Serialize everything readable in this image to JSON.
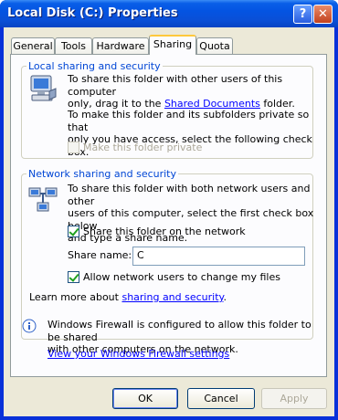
{
  "window": {
    "title": "Local Disk (C:) Properties",
    "help_glyph": "?",
    "close_glyph": "✕"
  },
  "tabs": [
    {
      "label": "General"
    },
    {
      "label": "Tools"
    },
    {
      "label": "Hardware"
    },
    {
      "label": "Sharing",
      "active": true
    },
    {
      "label": "Quota"
    }
  ],
  "local": {
    "legend": "Local sharing and security",
    "p1_line1": "To share this folder with other users of this computer",
    "p1_line2_a": "only, drag it to the ",
    "p1_line2_link": "Shared Documents",
    "p1_line2_b": " folder.",
    "p2_line1": "To make this folder and its subfolders private so that",
    "p2_line2": "only you have access, select the following check box.",
    "private_label": "Make this folder private",
    "private_checked": false,
    "private_enabled": false
  },
  "network": {
    "legend": "Network sharing and security",
    "p_line1": "To share this folder with both network users and other",
    "p_line2": "users of this computer, select the first check box below",
    "p_line3": "and type a share name.",
    "share_label": "Share this folder on the network",
    "share_checked": true,
    "share_name_label": "Share name:",
    "share_name_value": "C",
    "allow_label": "Allow network users to change my files",
    "allow_checked": true,
    "learn_more_prefix": "Learn more about ",
    "learn_more_link": "sharing and security",
    "learn_more_suffix": "."
  },
  "firewall": {
    "line1": "Windows Firewall is configured to allow this folder to be shared",
    "line2": "with other computers on the network.",
    "link": "View your Windows Firewall settings"
  },
  "buttons": {
    "ok": "OK",
    "cancel": "Cancel",
    "apply": "Apply"
  },
  "colors": {
    "title_blue": "#0a5fe8",
    "legend_blue": "#0046d5",
    "face": "#ece9d8",
    "link": "#0000ff"
  }
}
